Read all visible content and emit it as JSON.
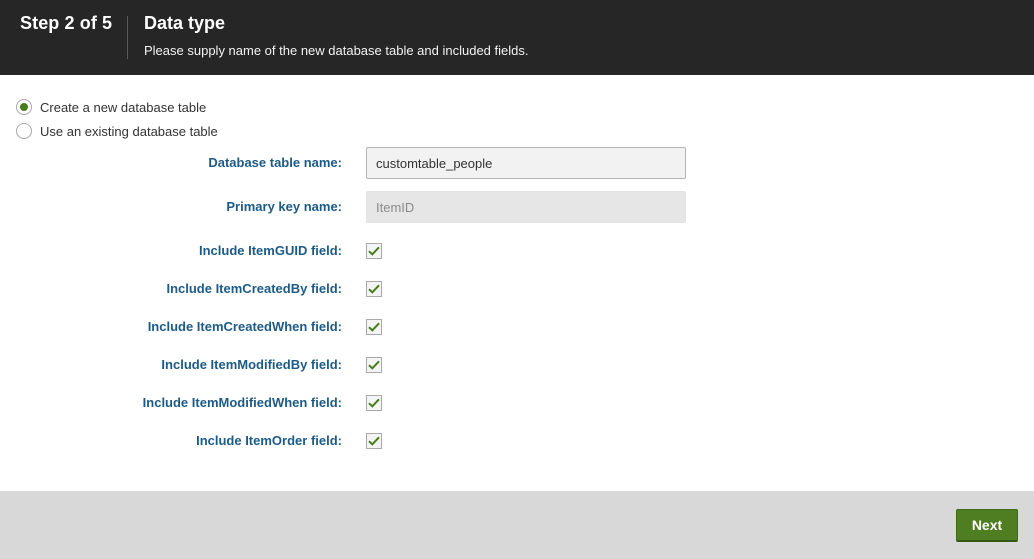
{
  "header": {
    "step": "Step 2 of 5",
    "title": "Data type",
    "subtitle": "Please supply name of the new database table and included fields."
  },
  "table_mode": {
    "options": [
      {
        "label": "Create a new database table",
        "selected": true
      },
      {
        "label": "Use an existing database table",
        "selected": false
      }
    ]
  },
  "form": {
    "table_name": {
      "label": "Database table name:",
      "value": "customtable_people"
    },
    "primary_key": {
      "label": "Primary key name:",
      "value": "ItemID"
    },
    "fields": [
      {
        "label": "Include ItemGUID field:",
        "checked": true
      },
      {
        "label": "Include ItemCreatedBy field:",
        "checked": true
      },
      {
        "label": "Include ItemCreatedWhen field:",
        "checked": true
      },
      {
        "label": "Include ItemModifiedBy field:",
        "checked": true
      },
      {
        "label": "Include ItemModifiedWhen field:",
        "checked": true
      },
      {
        "label": "Include ItemOrder field:",
        "checked": true
      }
    ]
  },
  "footer": {
    "next_label": "Next"
  },
  "colors": {
    "header_bg": "#262626",
    "label_blue": "#1d5b86",
    "accent_green": "#4f7d22",
    "footer_bg": "#d8d8d8"
  }
}
